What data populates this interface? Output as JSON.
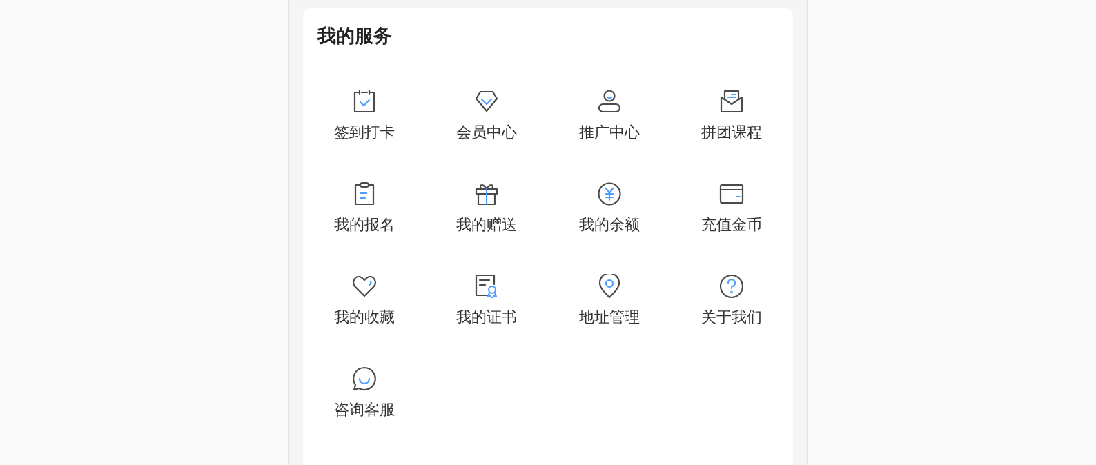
{
  "section": {
    "title": "我的服务",
    "items": [
      {
        "kind": "checkin",
        "label": "签到打卡"
      },
      {
        "kind": "diamond",
        "label": "会员中心"
      },
      {
        "kind": "person",
        "label": "推广中心"
      },
      {
        "kind": "mail",
        "label": "拼团课程"
      },
      {
        "kind": "clipboard",
        "label": "我的报名"
      },
      {
        "kind": "gift",
        "label": "我的赠送"
      },
      {
        "kind": "yen",
        "label": "我的余额"
      },
      {
        "kind": "card",
        "label": "充值金币"
      },
      {
        "kind": "heart",
        "label": "我的收藏"
      },
      {
        "kind": "certificate",
        "label": "我的证书"
      },
      {
        "kind": "pin",
        "label": "地址管理"
      },
      {
        "kind": "question",
        "label": "关于我们"
      },
      {
        "kind": "chat",
        "label": "咨询客服"
      }
    ]
  }
}
